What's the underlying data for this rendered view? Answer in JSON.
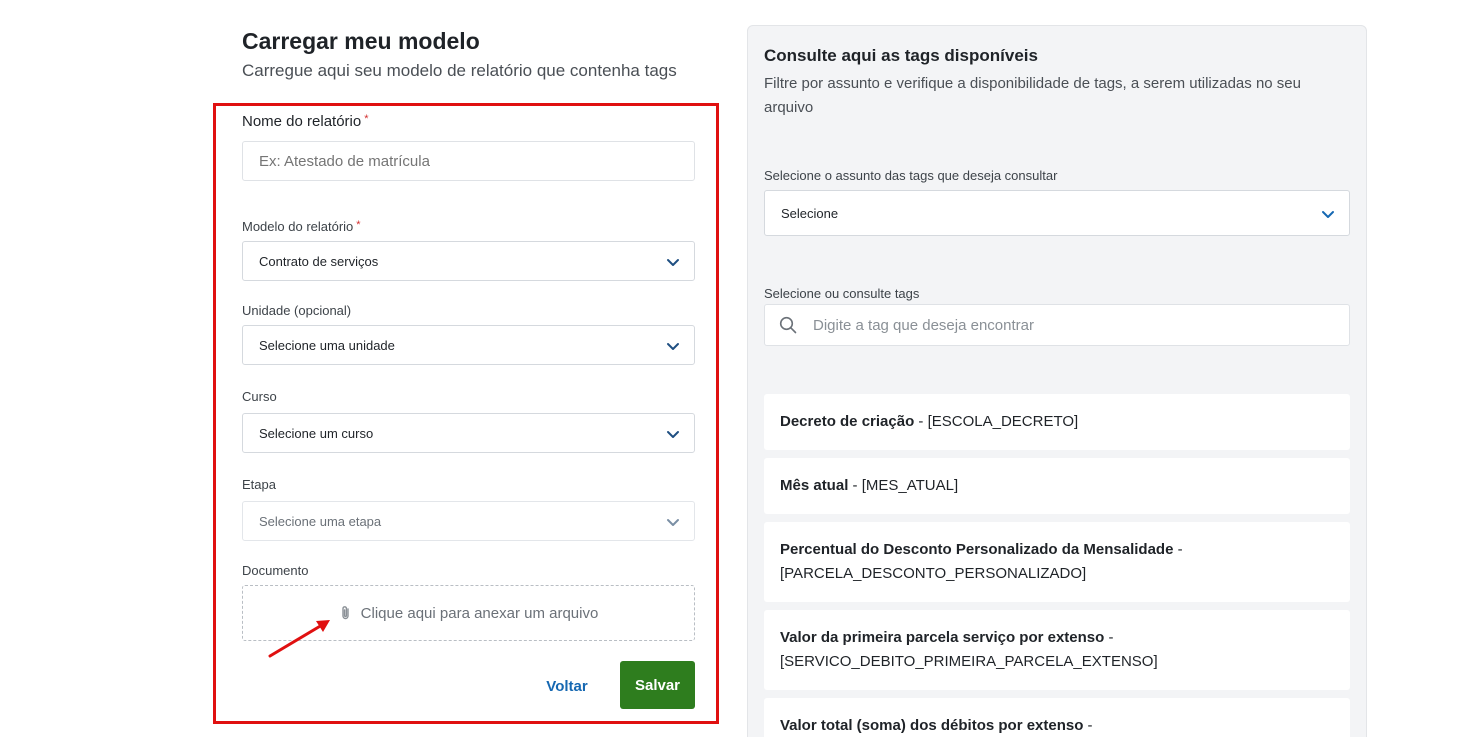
{
  "form": {
    "title": "Carregar meu modelo",
    "subtitle": "Carregue aqui seu modelo de relatório que contenha tags",
    "report_name": {
      "label": "Nome do relatório",
      "required_mark": "*",
      "placeholder": "Ex: Atestado de matrícula"
    },
    "report_model": {
      "label": "Modelo do relatório",
      "required_mark": "*",
      "value": "Contrato de serviços"
    },
    "unit": {
      "label": "Unidade (opcional)",
      "value": "Selecione uma unidade"
    },
    "course": {
      "label": "Curso",
      "value": "Selecione um curso"
    },
    "stage": {
      "label": "Etapa",
      "value": "Selecione uma etapa"
    },
    "document": {
      "label": "Documento",
      "upload_text": "Clique aqui para anexar um arquivo"
    },
    "back_label": "Voltar",
    "save_label": "Salvar"
  },
  "tags_panel": {
    "title": "Consulte aqui as tags disponíveis",
    "description": "Filtre por assunto e verifique a disponibilidade de tags, a serem utilizadas no seu arquivo",
    "subject": {
      "label": "Selecione o assunto das tags que deseja consultar",
      "value": "Selecione"
    },
    "search": {
      "label": "Selecione ou consulte tags",
      "placeholder": "Digite a tag que deseja encontrar"
    },
    "tags": [
      {
        "name": "Decreto de criação",
        "sep": " - ",
        "code": "[ESCOLA_DECRETO]"
      },
      {
        "name": "Mês atual",
        "sep": " - ",
        "code": "[MES_ATUAL]"
      },
      {
        "name": "Percentual do Desconto Personalizado da Mensalidade",
        "sep": " - ",
        "code": "[PARCELA_DESCONTO_PERSONALIZADO]"
      },
      {
        "name": "Valor da primeira parcela serviço por extenso",
        "sep": " - ",
        "code": "[SERVICO_DEBITO_PRIMEIRA_PARCELA_EXTENSO]"
      },
      {
        "name": "Valor total (soma) dos débitos por extenso",
        "sep": " - ",
        "code": ""
      }
    ]
  },
  "colors": {
    "accent_save": "#2e7d1e",
    "link_blue": "#1668b2",
    "annotation_red": "#e01010",
    "required_red": "#d32f2f"
  },
  "icons": {
    "chevron": "chevron-down-icon",
    "attachment": "paperclip-icon",
    "search": "search-icon",
    "annotation": "red-arrow-icon"
  }
}
